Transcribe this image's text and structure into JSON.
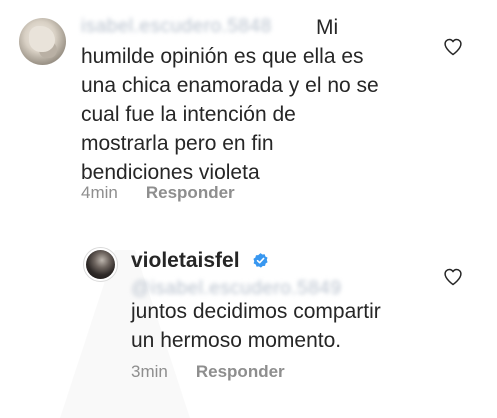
{
  "comment_1": {
    "author_blurred": "isabel.escudero.5848",
    "text_lines": [
      "Mi",
      "humilde opinión es que ella es",
      "una chica enamorada y el no se",
      "cual fue la intención de",
      "mostrarla pero en fin",
      "bendiciones violeta"
    ],
    "time": "4min",
    "reply_label": "Responder"
  },
  "comment_2": {
    "username": "violetaisfel",
    "mention_blurred": "@isabel.escudero.5849",
    "text_lines": [
      "juntos decidimos compartir",
      "un hermoso momento."
    ],
    "time": "3min",
    "reply_label": "Responder"
  },
  "icons": {
    "like": "heart-outline-icon",
    "verified": "verified-badge-icon"
  },
  "colors": {
    "text": "#262626",
    "meta": "#8e8e8e",
    "verified": "#3897f0",
    "mention_blur": "#b9c2ce"
  }
}
